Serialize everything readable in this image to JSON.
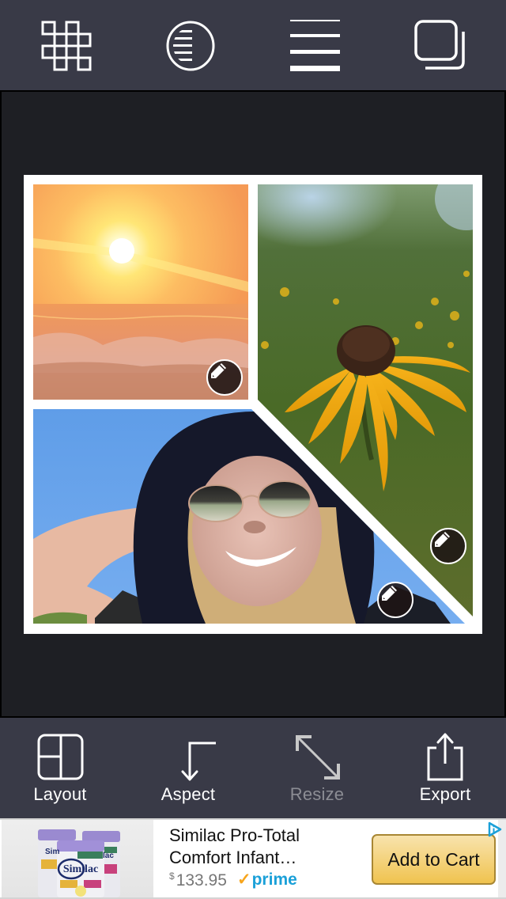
{
  "top_toolbar": {
    "buttons": [
      {
        "name": "grid-pattern",
        "icon": "grid-pattern-icon"
      },
      {
        "name": "filter",
        "icon": "half-lines-circle-icon"
      },
      {
        "name": "border-width",
        "icon": "line-weights-icon"
      },
      {
        "name": "layers",
        "icon": "stacked-squares-icon"
      }
    ]
  },
  "collage": {
    "cells": [
      {
        "name": "sunset-ocean-photo",
        "edit_icon": "pencil-icon"
      },
      {
        "name": "sunflower-photo",
        "edit_icon": "pencil-icon"
      },
      {
        "name": "selfie-hat-photo",
        "edit_icon": "pencil-icon"
      }
    ]
  },
  "bottom_toolbar": {
    "buttons": [
      {
        "label": "Layout",
        "icon": "layout-icon",
        "enabled": true
      },
      {
        "label": "Aspect",
        "icon": "aspect-arrows-icon",
        "enabled": true
      },
      {
        "label": "Resize",
        "icon": "resize-diagonal-icon",
        "enabled": false
      },
      {
        "label": "Export",
        "icon": "share-icon",
        "enabled": true
      }
    ]
  },
  "ad": {
    "title": "Similac Pro-Total Comfort Infant…",
    "price_currency": "$",
    "price": "133.95",
    "prime_check": "✓",
    "prime_label": "prime",
    "cta_label": "Add to Cart",
    "product_brand": "Similac",
    "colors": {
      "cta_top": "#f8e3ad",
      "cta_bottom": "#f0c34f",
      "prime_blue": "#1aa0d8",
      "prime_orange": "#f7a51c"
    }
  },
  "theme": {
    "toolbar_bg": "#393a47",
    "canvas_bg": "#1e1f24",
    "frame_color": "#ffffff"
  }
}
